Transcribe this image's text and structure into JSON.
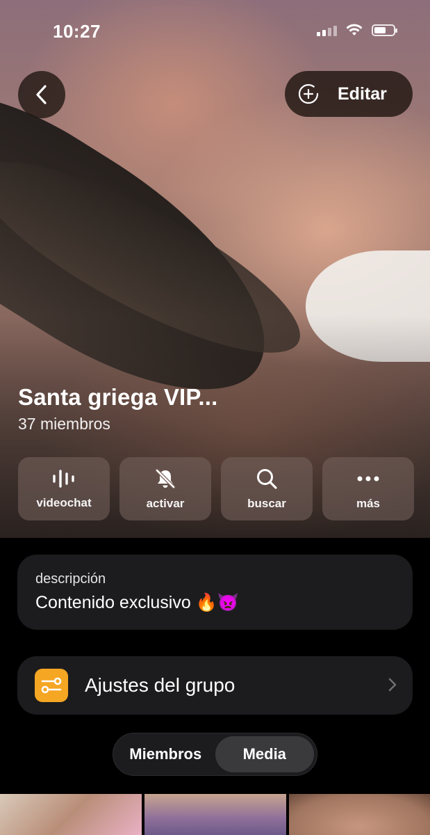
{
  "status_bar": {
    "time": "10:27",
    "icons": [
      "signal-icon",
      "wifi-icon",
      "battery-icon"
    ]
  },
  "header": {
    "back_icon": "chevron-left-icon",
    "edit_icon": "add-circle-icon",
    "edit_label": "Editar"
  },
  "group": {
    "name": "Santa griega VIP...",
    "members": "37 miembros"
  },
  "actions": [
    {
      "icon": "voice-wave-icon",
      "label": "videochat"
    },
    {
      "icon": "bell-muted-icon",
      "label": "activar"
    },
    {
      "icon": "search-icon",
      "label": "buscar"
    },
    {
      "icon": "ellipsis-icon",
      "label": "más"
    }
  ],
  "description": {
    "label": "descripción",
    "text": "Contenido exclusivo 🔥👿"
  },
  "settings": {
    "icon": "sliders-icon",
    "label": "Ajustes del grupo",
    "accent": "#f5a623"
  },
  "tabs": {
    "items": [
      "Miembros",
      "Media"
    ],
    "selected": "Media"
  },
  "colors": {
    "card_bg": "#1c1c1e",
    "page_bg": "#000000"
  }
}
